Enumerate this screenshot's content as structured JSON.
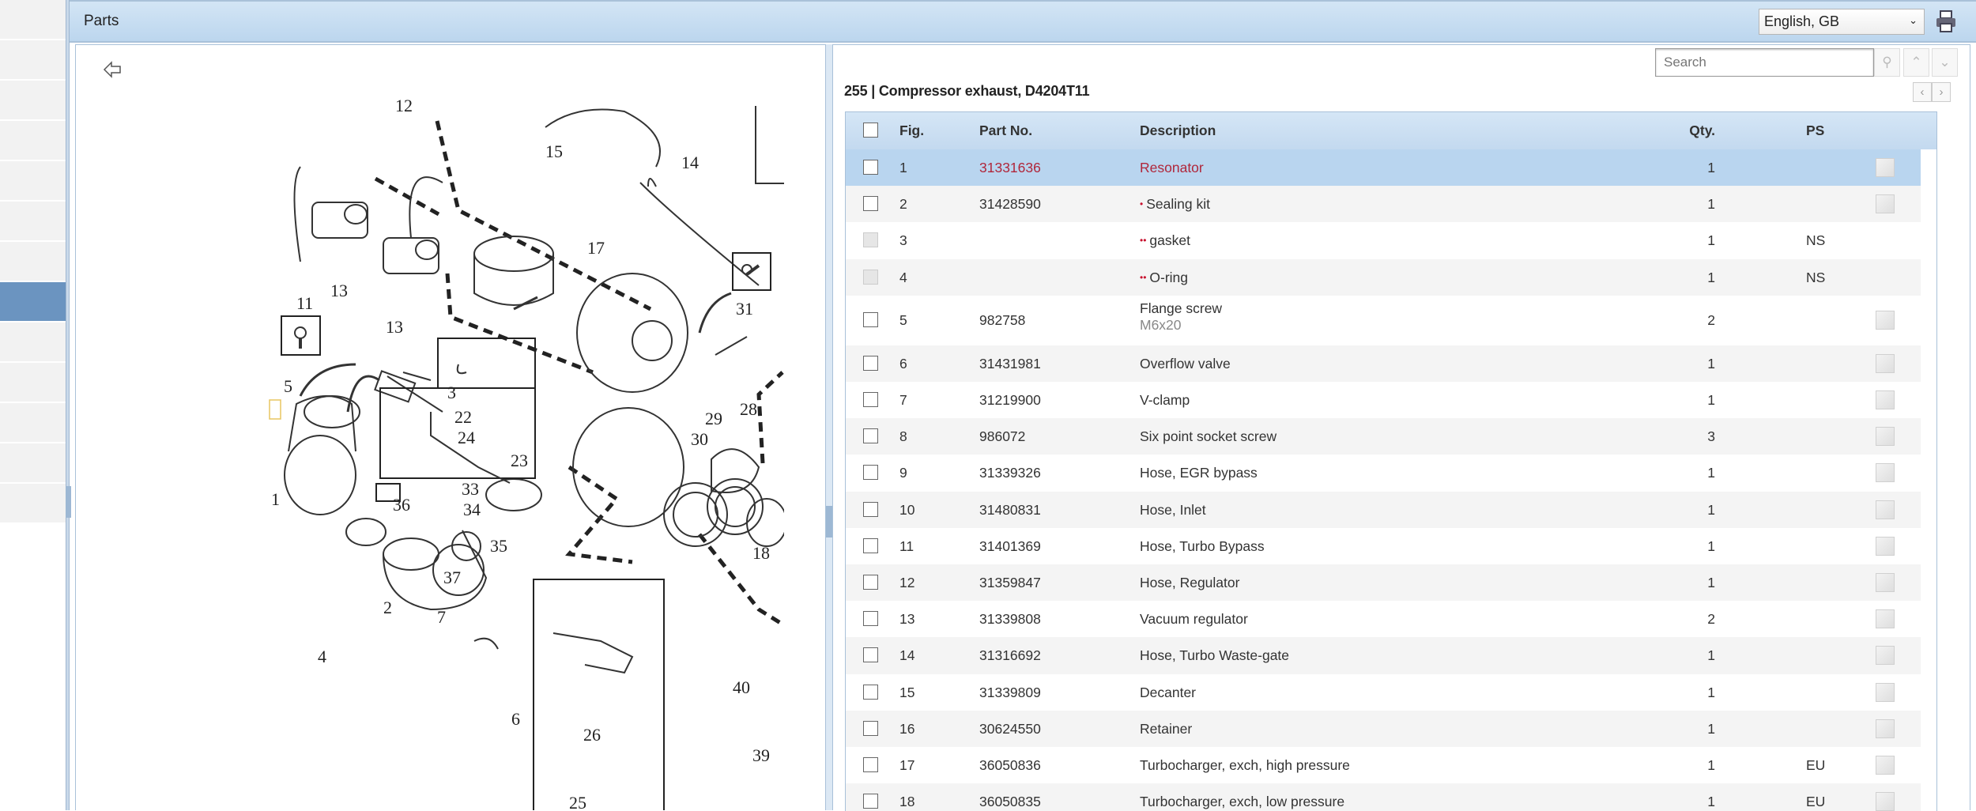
{
  "header": {
    "title": "Parts",
    "language": "English, GB"
  },
  "search": {
    "placeholder": "Search"
  },
  "group": {
    "title": "255  |  Compressor exhaust, D4204T11"
  },
  "table": {
    "headers": {
      "fig": "Fig.",
      "part": "Part No.",
      "desc": "Description",
      "qty": "Qty.",
      "ps": "PS"
    },
    "rows": [
      {
        "fig": "1",
        "part": "31331636",
        "desc": "Resonator",
        "qty": "1",
        "ps": "",
        "level": 0
      },
      {
        "fig": "2",
        "part": "31428590",
        "desc": "Sealing kit",
        "qty": "1",
        "ps": "",
        "level": 1
      },
      {
        "fig": "3",
        "part": "",
        "desc": "gasket",
        "qty": "1",
        "ps": "NS",
        "level": 2
      },
      {
        "fig": "4",
        "part": "",
        "desc": "O-ring",
        "qty": "1",
        "ps": "NS",
        "level": 2
      },
      {
        "fig": "5",
        "part": "982758",
        "desc": "Flange screw",
        "sub": "M6x20",
        "qty": "2",
        "ps": "",
        "level": 0
      },
      {
        "fig": "6",
        "part": "31431981",
        "desc": "Overflow valve",
        "qty": "1",
        "ps": "",
        "level": 0
      },
      {
        "fig": "7",
        "part": "31219900",
        "desc": "V-clamp",
        "qty": "1",
        "ps": "",
        "level": 0
      },
      {
        "fig": "8",
        "part": "986072",
        "desc": "Six point socket screw",
        "qty": "3",
        "ps": "",
        "level": 0
      },
      {
        "fig": "9",
        "part": "31339326",
        "desc": "Hose, EGR bypass",
        "qty": "1",
        "ps": "",
        "level": 0
      },
      {
        "fig": "10",
        "part": "31480831",
        "desc": "Hose, Inlet",
        "qty": "1",
        "ps": "",
        "level": 0
      },
      {
        "fig": "11",
        "part": "31401369",
        "desc": "Hose, Turbo Bypass",
        "qty": "1",
        "ps": "",
        "level": 0
      },
      {
        "fig": "12",
        "part": "31359847",
        "desc": "Hose, Regulator",
        "qty": "1",
        "ps": "",
        "level": 0
      },
      {
        "fig": "13",
        "part": "31339808",
        "desc": "Vacuum regulator",
        "qty": "2",
        "ps": "",
        "level": 0
      },
      {
        "fig": "14",
        "part": "31316692",
        "desc": "Hose, Turbo Waste-gate",
        "qty": "1",
        "ps": "",
        "level": 0
      },
      {
        "fig": "15",
        "part": "31339809",
        "desc": "Decanter",
        "qty": "1",
        "ps": "",
        "level": 0
      },
      {
        "fig": "16",
        "part": "30624550",
        "desc": "Retainer",
        "qty": "1",
        "ps": "",
        "level": 0
      },
      {
        "fig": "17",
        "part": "36050836",
        "desc": "Turbocharger, exch, high pressure",
        "qty": "1",
        "ps": "EU",
        "level": 0
      },
      {
        "fig": "18",
        "part": "36050835",
        "desc": "Turbocharger, exch, low pressure",
        "qty": "1",
        "ps": "EU",
        "level": 0
      }
    ]
  },
  "diagram": {
    "callouts": [
      "12",
      "15",
      "14",
      "17",
      "31",
      "11",
      "13",
      "13",
      "5",
      "3",
      "22",
      "24",
      "23",
      "28",
      "29",
      "30",
      "1",
      "33",
      "36",
      "34",
      "35",
      "37",
      "18",
      "2",
      "7",
      "4",
      "40",
      "6",
      "26",
      "39",
      "25"
    ]
  },
  "colors": {
    "accent": "#b9d5ef",
    "highlight": "#b0263a",
    "sidebar_selected": "#6b94c0"
  }
}
